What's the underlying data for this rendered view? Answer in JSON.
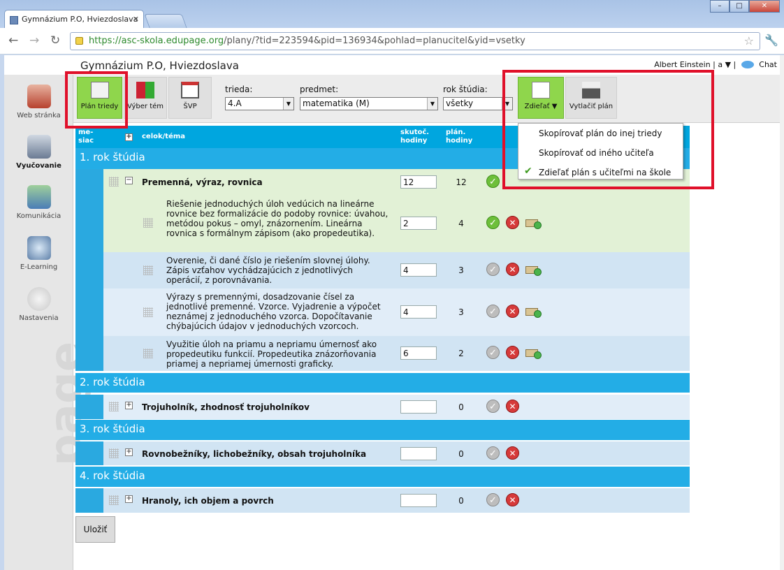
{
  "browser": {
    "tab_title": "Gymnázium P.O, Hviezdoslava",
    "url_scheme": "https://",
    "url_host": "asc-skola.edupage.org",
    "url_path": "/plany/?tid=223594&pid=136934&pohlad=planucitel&yid=vsetky",
    "window_buttons": [
      "–",
      "□",
      "✕"
    ]
  },
  "site": {
    "title": "Gymnázium P.O, Hviezdoslava",
    "user": "Albert Einstein | a ▼ |",
    "chat": "Chat"
  },
  "leftnav": [
    {
      "label": "Web stránka",
      "icon": "house-icon"
    },
    {
      "label": "Vyučovanie",
      "icon": "book-icon"
    },
    {
      "label": "Komunikácia",
      "icon": "people-icon"
    },
    {
      "label": "E-Learning",
      "icon": "globe-icon"
    },
    {
      "label": "Nastavenia",
      "icon": "gear-icon"
    }
  ],
  "watermark": "page",
  "tools": {
    "plan_triedy": "Plán triedy",
    "vyber_tem": "Výber tém",
    "svp": "ŠVP",
    "trieda_label": "trieda:",
    "trieda_value": "4.A",
    "predmet_label": "predmet:",
    "predmet_value": "matematika (M)",
    "rok_label": "rok štúdia:",
    "rok_value": "všetky",
    "zdielat": "Zdieľať ▼",
    "vytlacit": "Vytlačiť plán"
  },
  "share_menu": [
    "Skopírovať plán do inej triedy",
    "Skopírovať od iného učiteľa",
    "Zdieľať plán s učiteľmi na škole"
  ],
  "table": {
    "headers": {
      "mesiac": "me-siac",
      "celok": "celok/téma",
      "skutoc": "skutoč. hodiny",
      "plan": "plán. hodiny"
    },
    "sections": [
      {
        "title": "1. rok štúdia"
      },
      {
        "title": "2. rok štúdia"
      },
      {
        "title": "3. rok štúdia"
      },
      {
        "title": "4. rok štúdia"
      }
    ],
    "topics": [
      {
        "name": "Premenná, výraz, rovnica",
        "hours": "12",
        "plan": "12"
      },
      {
        "name": "Trojuholník, zhodnosť trojuholníkov",
        "hours": "",
        "plan": "0"
      },
      {
        "name": "Rovnobežníky, lichobežníky, obsah trojuholníka",
        "hours": "",
        "plan": "0"
      },
      {
        "name": "Hranoly, ich objem a povrch",
        "hours": "",
        "plan": "0"
      }
    ],
    "subtopics": [
      {
        "text": "Riešenie jednoduchých úloh vedúcich na lineárne rovnice bez formalizácie do podoby rovnice: úvahou, metódou pokus – omyl, znázornením. Lineárna rovnica s formálnym zápisom (ako propedeutika).",
        "hours": "2",
        "plan": "4"
      },
      {
        "text": "Overenie, či dané číslo je riešením slovnej úlohy. Zápis vzťahov vychádzajúcich z jednotlivých operácií, z porovnávania.",
        "hours": "4",
        "plan": "3"
      },
      {
        "text": "Výrazy s premennými, dosadzovanie čísel za jednotlivé premenné. Vzorce. Vyjadrenie a výpočet neznámej z jednoduchého vzorca. Dopočítavanie chýbajúcich údajov v jednoduchých vzorcoch.",
        "hours": "4",
        "plan": "3"
      },
      {
        "text": "Využitie úloh na priamu a nepriamu úmernosť ako propedeutiku funkcií. Propedeutika znázorňovania priamej a nepriamej úmernosti graficky.",
        "hours": "6",
        "plan": "2"
      }
    ]
  },
  "save_button": "Uložiť",
  "colors": {
    "accent": "#00a6df",
    "green_button": "#8fd64c",
    "highlight_red": "#e0102a"
  }
}
